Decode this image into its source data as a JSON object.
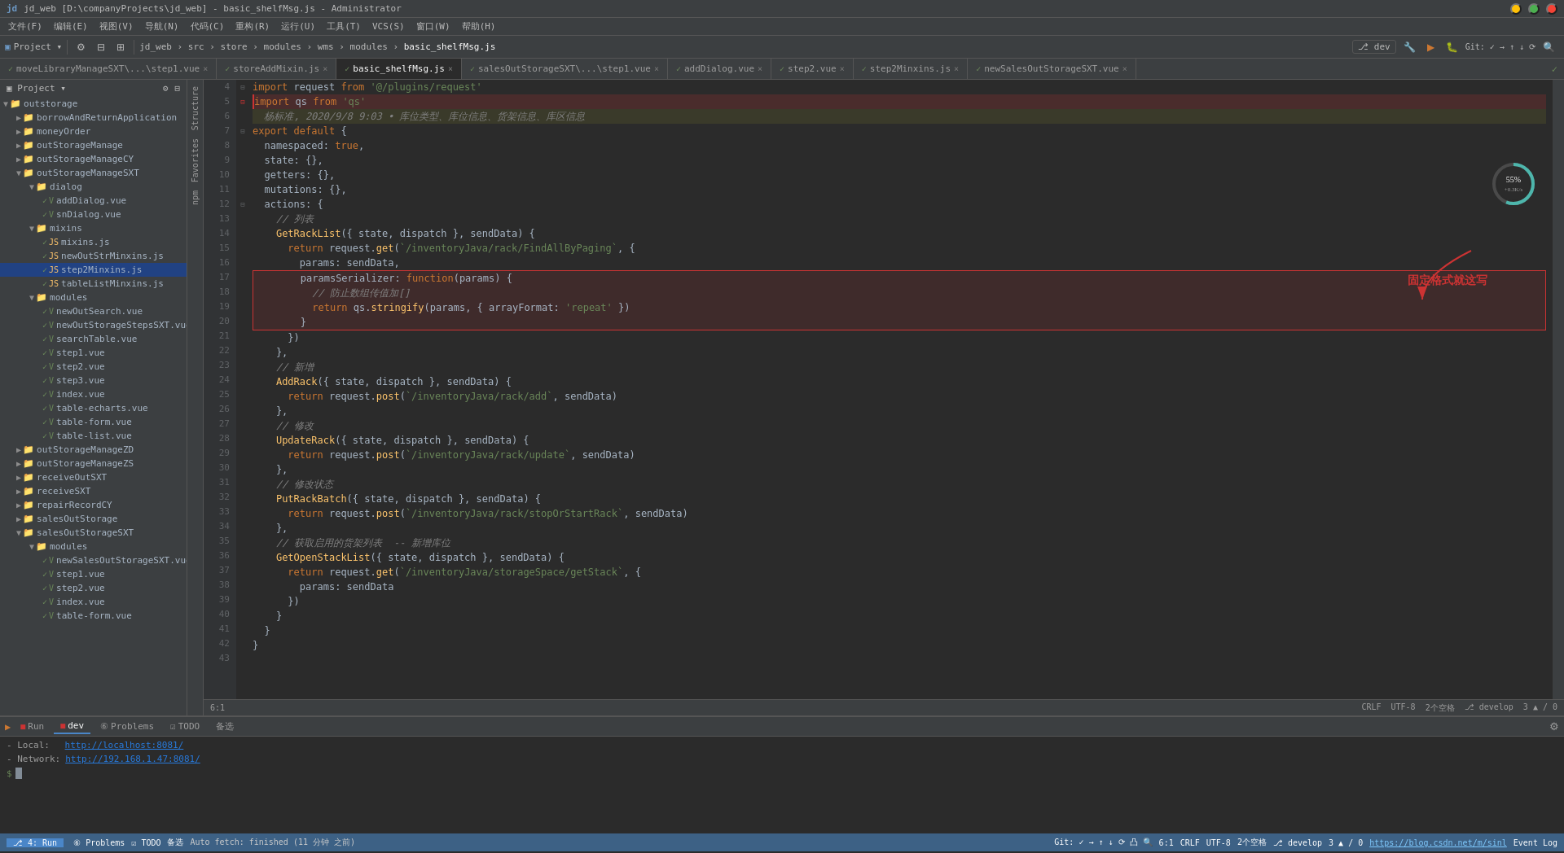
{
  "titleBar": {
    "title": "jd_web [D:\\companyProjects\\jd_web] - basic_shelfMsg.js - Administrator",
    "minimizeLabel": "─",
    "maximizeLabel": "□",
    "closeLabel": "✕"
  },
  "menuBar": {
    "items": [
      "文件(F)",
      "编辑(E)",
      "视图(V)",
      "导航(N)",
      "代码(C)",
      "重构(R)",
      "运行(U)",
      "工具(T)",
      "VCS(S)",
      "窗口(W)",
      "帮助(H)"
    ]
  },
  "toolbar": {
    "breadcrumb": "jd_web › src › store › modules › wms › modules › basic_shelfMsg.js",
    "devBranch": "dev"
  },
  "tabs": [
    {
      "label": "moveLibraryManageSXT\\...\\step1.vue",
      "active": false,
      "modified": false,
      "color": "green"
    },
    {
      "label": "storeAddMixin.js",
      "active": false,
      "modified": false,
      "color": "green"
    },
    {
      "label": "basic_shelfMsg.js",
      "active": true,
      "modified": false,
      "color": "green"
    },
    {
      "label": "salesOutStorageSXT\\...\\step1.vue",
      "active": false,
      "modified": false,
      "color": "green"
    },
    {
      "label": "addDialog.vue",
      "active": false,
      "modified": false,
      "color": "green"
    },
    {
      "label": "step2.vue",
      "active": false,
      "modified": false,
      "color": "green"
    },
    {
      "label": "step2Minxins.js",
      "active": false,
      "modified": false,
      "color": "green"
    },
    {
      "label": "newSalesOutStorageSXT.vue",
      "active": false,
      "modified": false,
      "color": "green"
    }
  ],
  "sidebar": {
    "projectLabel": "Project",
    "items": [
      {
        "label": "outstorage",
        "level": 0,
        "type": "folder",
        "expanded": true
      },
      {
        "label": "borrowAndReturnApplication",
        "level": 1,
        "type": "folder",
        "expanded": false
      },
      {
        "label": "moneyOrder",
        "level": 1,
        "type": "folder",
        "expanded": false
      },
      {
        "label": "outStorageManage",
        "level": 1,
        "type": "folder",
        "expanded": false
      },
      {
        "label": "outStorageManageCY",
        "level": 1,
        "type": "folder",
        "expanded": false
      },
      {
        "label": "outStorageManageSXT",
        "level": 1,
        "type": "folder",
        "expanded": true
      },
      {
        "label": "dialog",
        "level": 2,
        "type": "folder",
        "expanded": true
      },
      {
        "label": "addDialog.vue",
        "level": 3,
        "type": "vue"
      },
      {
        "label": "snDialog.vue",
        "level": 3,
        "type": "vue"
      },
      {
        "label": "mixins",
        "level": 2,
        "type": "folder",
        "expanded": true
      },
      {
        "label": "mixins.js",
        "level": 3,
        "type": "js"
      },
      {
        "label": "newOutStrMinxins.js",
        "level": 3,
        "type": "js"
      },
      {
        "label": "step2Minxins.js",
        "level": 3,
        "type": "js",
        "selected": true
      },
      {
        "label": "tableListMinxins.js",
        "level": 3,
        "type": "js"
      },
      {
        "label": "modules",
        "level": 2,
        "type": "folder",
        "expanded": true
      },
      {
        "label": "newOutSearch.vue",
        "level": 3,
        "type": "vue"
      },
      {
        "label": "newOutStorageStepsSXT.vue",
        "level": 3,
        "type": "vue"
      },
      {
        "label": "searchTable.vue",
        "level": 3,
        "type": "vue"
      },
      {
        "label": "step1.vue",
        "level": 3,
        "type": "vue"
      },
      {
        "label": "step2.vue",
        "level": 3,
        "type": "vue"
      },
      {
        "label": "step3.vue",
        "level": 3,
        "type": "vue"
      },
      {
        "label": "index.vue",
        "level": 3,
        "type": "vue"
      },
      {
        "label": "table-echarts.vue",
        "level": 3,
        "type": "vue"
      },
      {
        "label": "table-form.vue",
        "level": 3,
        "type": "vue"
      },
      {
        "label": "table-list.vue",
        "level": 3,
        "type": "vue"
      },
      {
        "label": "outStorageManageZD",
        "level": 1,
        "type": "folder",
        "expanded": false
      },
      {
        "label": "outStorageManageZS",
        "level": 1,
        "type": "folder",
        "expanded": false
      },
      {
        "label": "receiveOutSXT",
        "level": 1,
        "type": "folder",
        "expanded": false
      },
      {
        "label": "receiveSXT",
        "level": 1,
        "type": "folder",
        "expanded": false
      },
      {
        "label": "repairRecordCY",
        "level": 1,
        "type": "folder",
        "expanded": false
      },
      {
        "label": "salesOutStorage",
        "level": 1,
        "type": "folder",
        "expanded": false
      },
      {
        "label": "salesOutStorageSXT",
        "level": 1,
        "type": "folder",
        "expanded": true
      },
      {
        "label": "modules",
        "level": 2,
        "type": "folder",
        "expanded": true
      },
      {
        "label": "newSalesOutStorageSXT.vue",
        "level": 3,
        "type": "vue"
      },
      {
        "label": "step1.vue",
        "level": 3,
        "type": "vue"
      },
      {
        "label": "step2.vue",
        "level": 3,
        "type": "vue"
      },
      {
        "label": "index.vue",
        "level": 3,
        "type": "vue"
      },
      {
        "label": "table-form.vue",
        "level": 3,
        "type": "vue"
      }
    ]
  },
  "code": {
    "filename": "basic_shelfMsg.js",
    "annotationText": "固定格式就这写",
    "lines": [
      {
        "num": 4,
        "content": "import request from '@/plugins/request'"
      },
      {
        "num": 5,
        "content": "import qs from 'qs'"
      },
      {
        "num": 6,
        "content": "  杨标准, 2020/9/8 9:03 • 库位类型、库位信息、货架信息、库区信息"
      },
      {
        "num": 7,
        "content": "export default {"
      },
      {
        "num": 8,
        "content": "  namespaced: true,"
      },
      {
        "num": 9,
        "content": "  state: {},"
      },
      {
        "num": 10,
        "content": "  getters: {},"
      },
      {
        "num": 11,
        "content": "  mutations: {},"
      },
      {
        "num": 12,
        "content": "  actions: {"
      },
      {
        "num": 13,
        "content": "    // 列表"
      },
      {
        "num": 14,
        "content": "    GetRackList({ state, dispatch }, sendData) {"
      },
      {
        "num": 15,
        "content": "      return request.get(`/inventoryJava/rack/FindAllByPaging`, {"
      },
      {
        "num": 16,
        "content": "        params: sendData,"
      },
      {
        "num": 17,
        "content": "        paramsSerializer: function(params) {"
      },
      {
        "num": 18,
        "content": "          // 防止数组传值加[]"
      },
      {
        "num": 19,
        "content": "          return qs.stringify(params, { arrayFormat: 'repeat' })"
      },
      {
        "num": 20,
        "content": "        }"
      },
      {
        "num": 21,
        "content": "      })"
      },
      {
        "num": 22,
        "content": "    },"
      },
      {
        "num": 23,
        "content": "    // 新增"
      },
      {
        "num": 24,
        "content": "    AddRack({ state, dispatch }, sendData) {"
      },
      {
        "num": 25,
        "content": "      return request.post(`/inventoryJava/rack/add`, sendData)"
      },
      {
        "num": 26,
        "content": "    },"
      },
      {
        "num": 27,
        "content": "    // 修改"
      },
      {
        "num": 28,
        "content": "    UpdateRack({ state, dispatch }, sendData) {"
      },
      {
        "num": 29,
        "content": "      return request.post(`/inventoryJava/rack/update`, sendData)"
      },
      {
        "num": 30,
        "content": "    },"
      },
      {
        "num": 31,
        "content": "    // 修改状态"
      },
      {
        "num": 32,
        "content": "    PutRackBatch({ state, dispatch }, sendData) {"
      },
      {
        "num": 33,
        "content": "      return request.post(`/inventoryJava/rack/stopOrStartRack`, sendData)"
      },
      {
        "num": 34,
        "content": "    },"
      },
      {
        "num": 35,
        "content": "    // 获取启用的货架列表  -- 新增库位"
      },
      {
        "num": 36,
        "content": "    GetOpenStackList({ state, dispatch }, sendData) {"
      },
      {
        "num": 37,
        "content": "      return request.get(`/inventoryJava/storageSpace/getStack`, {"
      },
      {
        "num": 38,
        "content": "        params: sendData"
      },
      {
        "num": 39,
        "content": "      })"
      },
      {
        "num": 40,
        "content": "    }"
      },
      {
        "num": 41,
        "content": "  }"
      },
      {
        "num": 42,
        "content": "}"
      },
      {
        "num": 43,
        "content": ""
      }
    ]
  },
  "bottomPanel": {
    "tabs": [
      {
        "label": "Run",
        "active": false,
        "icon": "run"
      },
      {
        "label": "dev",
        "active": true,
        "icon": "run"
      }
    ],
    "terminal": {
      "localLabel": "- Local:",
      "localUrl": "http://localhost:8081/",
      "networkLabel": "- Network:",
      "networkUrl": "http://192.168.1.47:8081/"
    }
  },
  "statusBar": {
    "gitInfo": "⎇ 4: Run",
    "problems": "⑥ Problems",
    "todo": "☑ TODO",
    "backfetch": "备选",
    "position": "6:1",
    "encoding": "CRLF  UTF-8",
    "spaces": "2个空格",
    "branch": "develop",
    "notifications": "3 ▲ / 0",
    "url": "https://blog.csdn.net/m/sinl",
    "eventLog": "Event Log",
    "gitStatus": "Git: ✓ → ↑ ↓ ⟳ 凸 🔍"
  },
  "gauge": {
    "percent": "55%",
    "sublabel": "+0.3K/s"
  }
}
